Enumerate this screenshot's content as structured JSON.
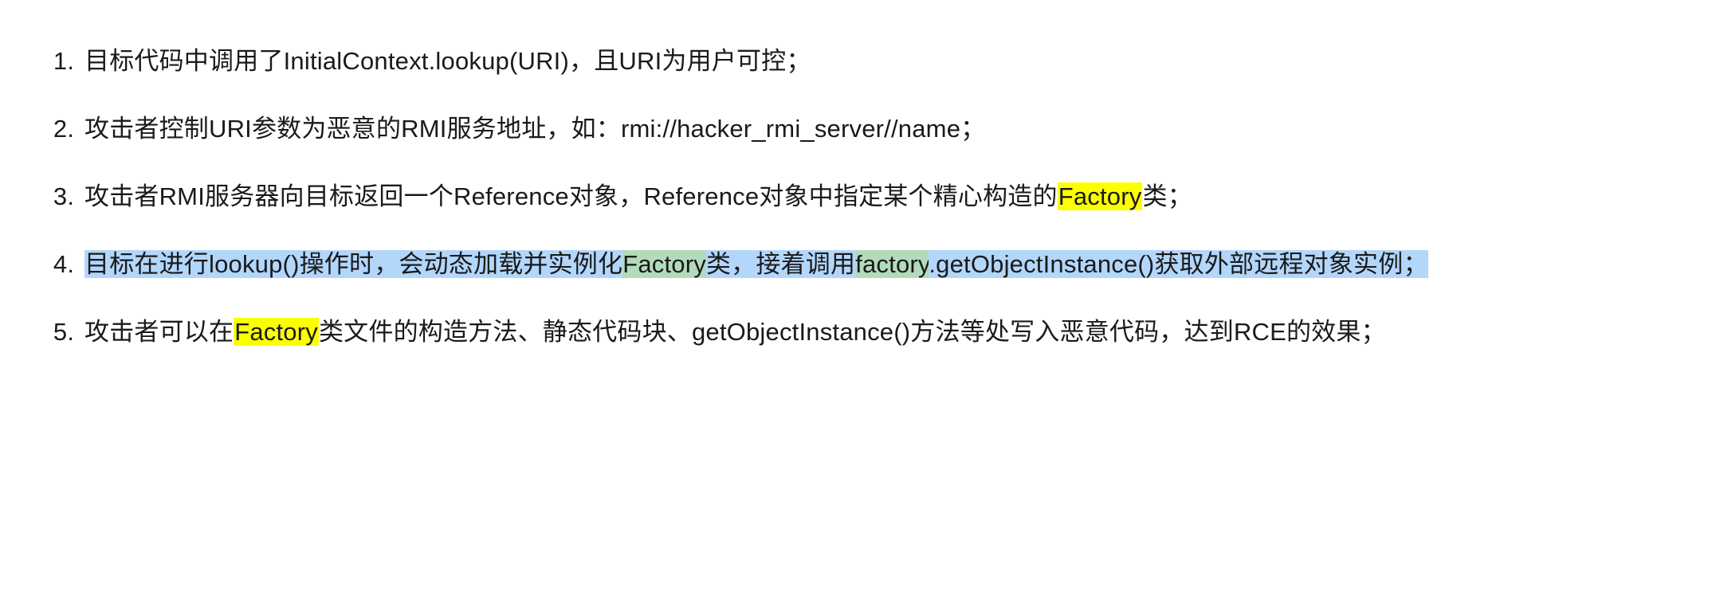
{
  "list": {
    "items": [
      {
        "parts": [
          {
            "t": "plain",
            "text": "目标代码中调用了InitialContext.lookup(URI)，且URI为用户可控；"
          }
        ]
      },
      {
        "parts": [
          {
            "t": "plain",
            "text": "攻击者控制URI参数为恶意的RMI服务地址，如：rmi://hacker_rmi_server//name；"
          }
        ]
      },
      {
        "parts": [
          {
            "t": "plain",
            "text": "攻击者RMI服务器向目标返回一个Reference对象，Reference对象中指定某个精心构造的"
          },
          {
            "t": "yellow",
            "text": "Factory"
          },
          {
            "t": "plain",
            "text": "类；"
          }
        ]
      },
      {
        "parts": [
          {
            "t": "sel",
            "text": "目标在进行lookup()操作时，会动态加载并实例化"
          },
          {
            "t": "green",
            "text": "Factory"
          },
          {
            "t": "sel",
            "text": "类，接着调用"
          },
          {
            "t": "green",
            "text": "factory"
          },
          {
            "t": "sel",
            "text": ".getObjectInstance()获取外部远程对象实例；"
          }
        ]
      },
      {
        "parts": [
          {
            "t": "plain",
            "text": "攻击者可以在"
          },
          {
            "t": "yellow",
            "text": "Factory"
          },
          {
            "t": "plain",
            "text": "类文件的构造方法、静态代码块、getObjectInstance()方法等处写入恶意代码，达到RCE的效果；"
          }
        ]
      }
    ]
  }
}
